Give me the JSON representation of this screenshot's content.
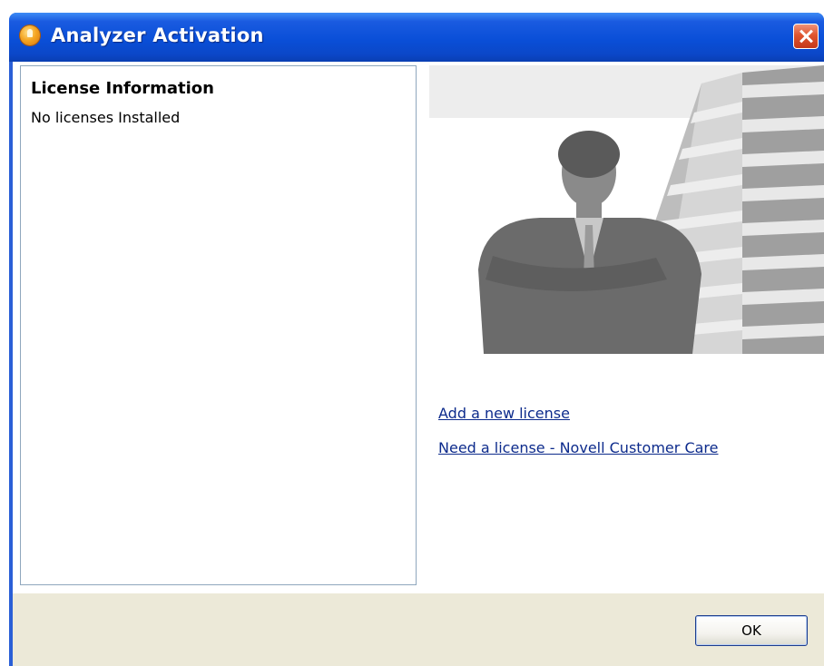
{
  "window": {
    "title": "Analyzer Activation",
    "icon": "analyzer-app-icon",
    "close_icon": "close-icon"
  },
  "license_panel": {
    "heading": "License Information",
    "status": "No licenses Installed"
  },
  "banner": {
    "image": "businessman-arms-crossed-building-banner"
  },
  "links": {
    "add_license": "Add a new license",
    "need_license": "Need a license - Novell Customer Care"
  },
  "buttons": {
    "ok_label": "OK"
  },
  "colors": {
    "titlebar": "#0a4fd8",
    "close_button": "#e0552f",
    "link": "#0d2b8c",
    "button_bar": "#ece9d8",
    "panel_border": "#8fa7bd"
  }
}
